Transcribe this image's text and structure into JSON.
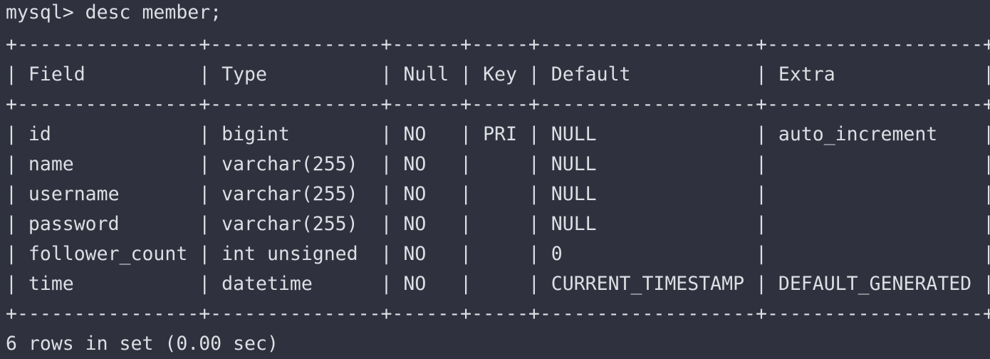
{
  "terminal": {
    "lines": [
      "mysql> desc member;",
      "+----------------+---------------+------+-----+-------------------+-------------------+",
      "| Field          | Type          | Null | Key | Default           | Extra             |",
      "+----------------+---------------+------+-----+-------------------+-------------------+",
      "| id             | bigint        | NO   | PRI | NULL              | auto_increment    |",
      "| name           | varchar(255)  | NO   |     | NULL              |                   |",
      "| username       | varchar(255)  | NO   |     | NULL              |                   |",
      "| password       | varchar(255)  | NO   |     | NULL              |                   |",
      "| follower_count | int unsigned  | NO   |     | 0                 |                   |",
      "| time           | datetime      | NO   |     | CURRENT_TIMESTAMP | DEFAULT_GENERATED |",
      "+----------------+---------------+------+-----+-------------------+-------------------+",
      "6 rows in set (0.00 sec)"
    ]
  },
  "colors": {
    "background": "#2f323e",
    "text": "#dcdfe4"
  }
}
